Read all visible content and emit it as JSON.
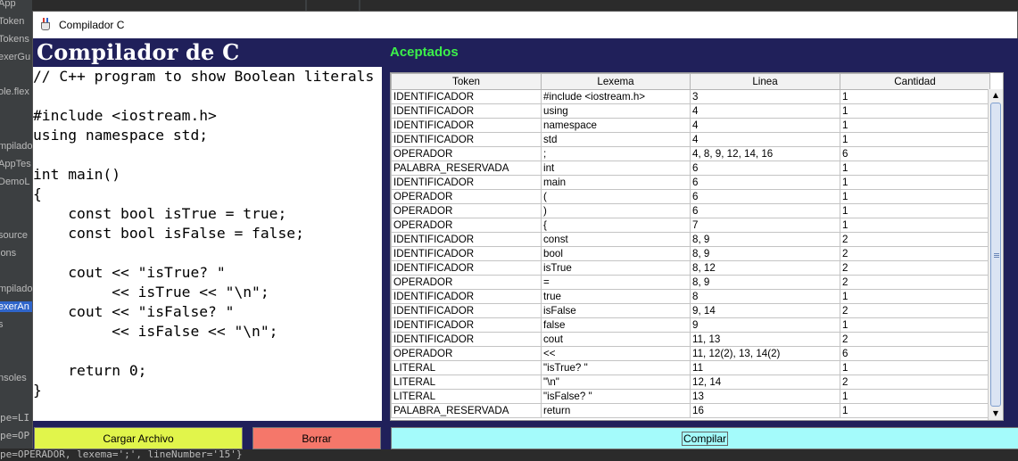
{
  "ide": {
    "left_items": [
      "App",
      "Token",
      "Tokens",
      "exerGu",
      "ole.flex",
      "mpilado",
      "AppTes",
      "DemoL",
      "source",
      "ions",
      "mpilado",
      "exerAn",
      "s",
      "nsoles"
    ],
    "log_lines": [
      "pe=LI",
      "pe=OP"
    ],
    "bottom_log": "pe=OPERADOR, lexema=';', lineNumber='15'}"
  },
  "window": {
    "title": "Compilador C",
    "icon": "java-cup-icon"
  },
  "app": {
    "heading": "Compilador de C",
    "accepted_label": "Aceptados",
    "buttons": {
      "load": "Cargar Archivo",
      "clear": "Borrar",
      "compile": "Compilar"
    }
  },
  "editor": {
    "lines": [
      "// C++ program to show Boolean literals",
      "",
      "#include <iostream.h>",
      "using namespace std;",
      "",
      "int main()",
      "{",
      "    const bool isTrue = true;",
      "    const bool isFalse = false;",
      "",
      "    cout << \"isTrue? \"",
      "         << isTrue << \"\\n\";",
      "    cout << \"isFalse? \"",
      "         << isFalse << \"\\n\";",
      "",
      "    return 0;",
      "}"
    ]
  },
  "table": {
    "columns": [
      "Token",
      "Lexema",
      "Linea",
      "Cantidad"
    ],
    "rows": [
      [
        "IDENTIFICADOR",
        "#include <iostream.h>",
        "3",
        "1"
      ],
      [
        "IDENTIFICADOR",
        "using",
        "4",
        "1"
      ],
      [
        "IDENTIFICADOR",
        "namespace",
        "4",
        "1"
      ],
      [
        "IDENTIFICADOR",
        "std",
        "4",
        "1"
      ],
      [
        "OPERADOR",
        ";",
        "4, 8, 9, 12, 14, 16",
        "6"
      ],
      [
        "PALABRA_RESERVADA",
        "int",
        "6",
        "1"
      ],
      [
        "IDENTIFICADOR",
        "main",
        "6",
        "1"
      ],
      [
        "OPERADOR",
        "(",
        "6",
        "1"
      ],
      [
        "OPERADOR",
        ")",
        "6",
        "1"
      ],
      [
        "OPERADOR",
        "{",
        "7",
        "1"
      ],
      [
        "IDENTIFICADOR",
        "const",
        "8, 9",
        "2"
      ],
      [
        "IDENTIFICADOR",
        "bool",
        "8, 9",
        "2"
      ],
      [
        "IDENTIFICADOR",
        "isTrue",
        "8, 12",
        "2"
      ],
      [
        "OPERADOR",
        "=",
        "8, 9",
        "2"
      ],
      [
        "IDENTIFICADOR",
        "true",
        "8",
        "1"
      ],
      [
        "IDENTIFICADOR",
        "isFalse",
        "9, 14",
        "2"
      ],
      [
        "IDENTIFICADOR",
        "false",
        "9",
        "1"
      ],
      [
        "IDENTIFICADOR",
        "cout",
        "11, 13",
        "2"
      ],
      [
        "OPERADOR",
        "<<",
        "11, 12(2), 13, 14(2)",
        "6"
      ],
      [
        "LITERAL",
        "\"isTrue? \"",
        "11",
        "1"
      ],
      [
        "LITERAL",
        "\"\\n\"",
        "12, 14",
        "2"
      ],
      [
        "LITERAL",
        "\"isFalse? \"",
        "13",
        "1"
      ],
      [
        "PALABRA_RESERVADA",
        "return",
        "16",
        "1"
      ]
    ]
  },
  "scrollbar": {
    "up_icon": "scroll-up-arrow-icon",
    "down_icon": "scroll-down-arrow-icon"
  }
}
